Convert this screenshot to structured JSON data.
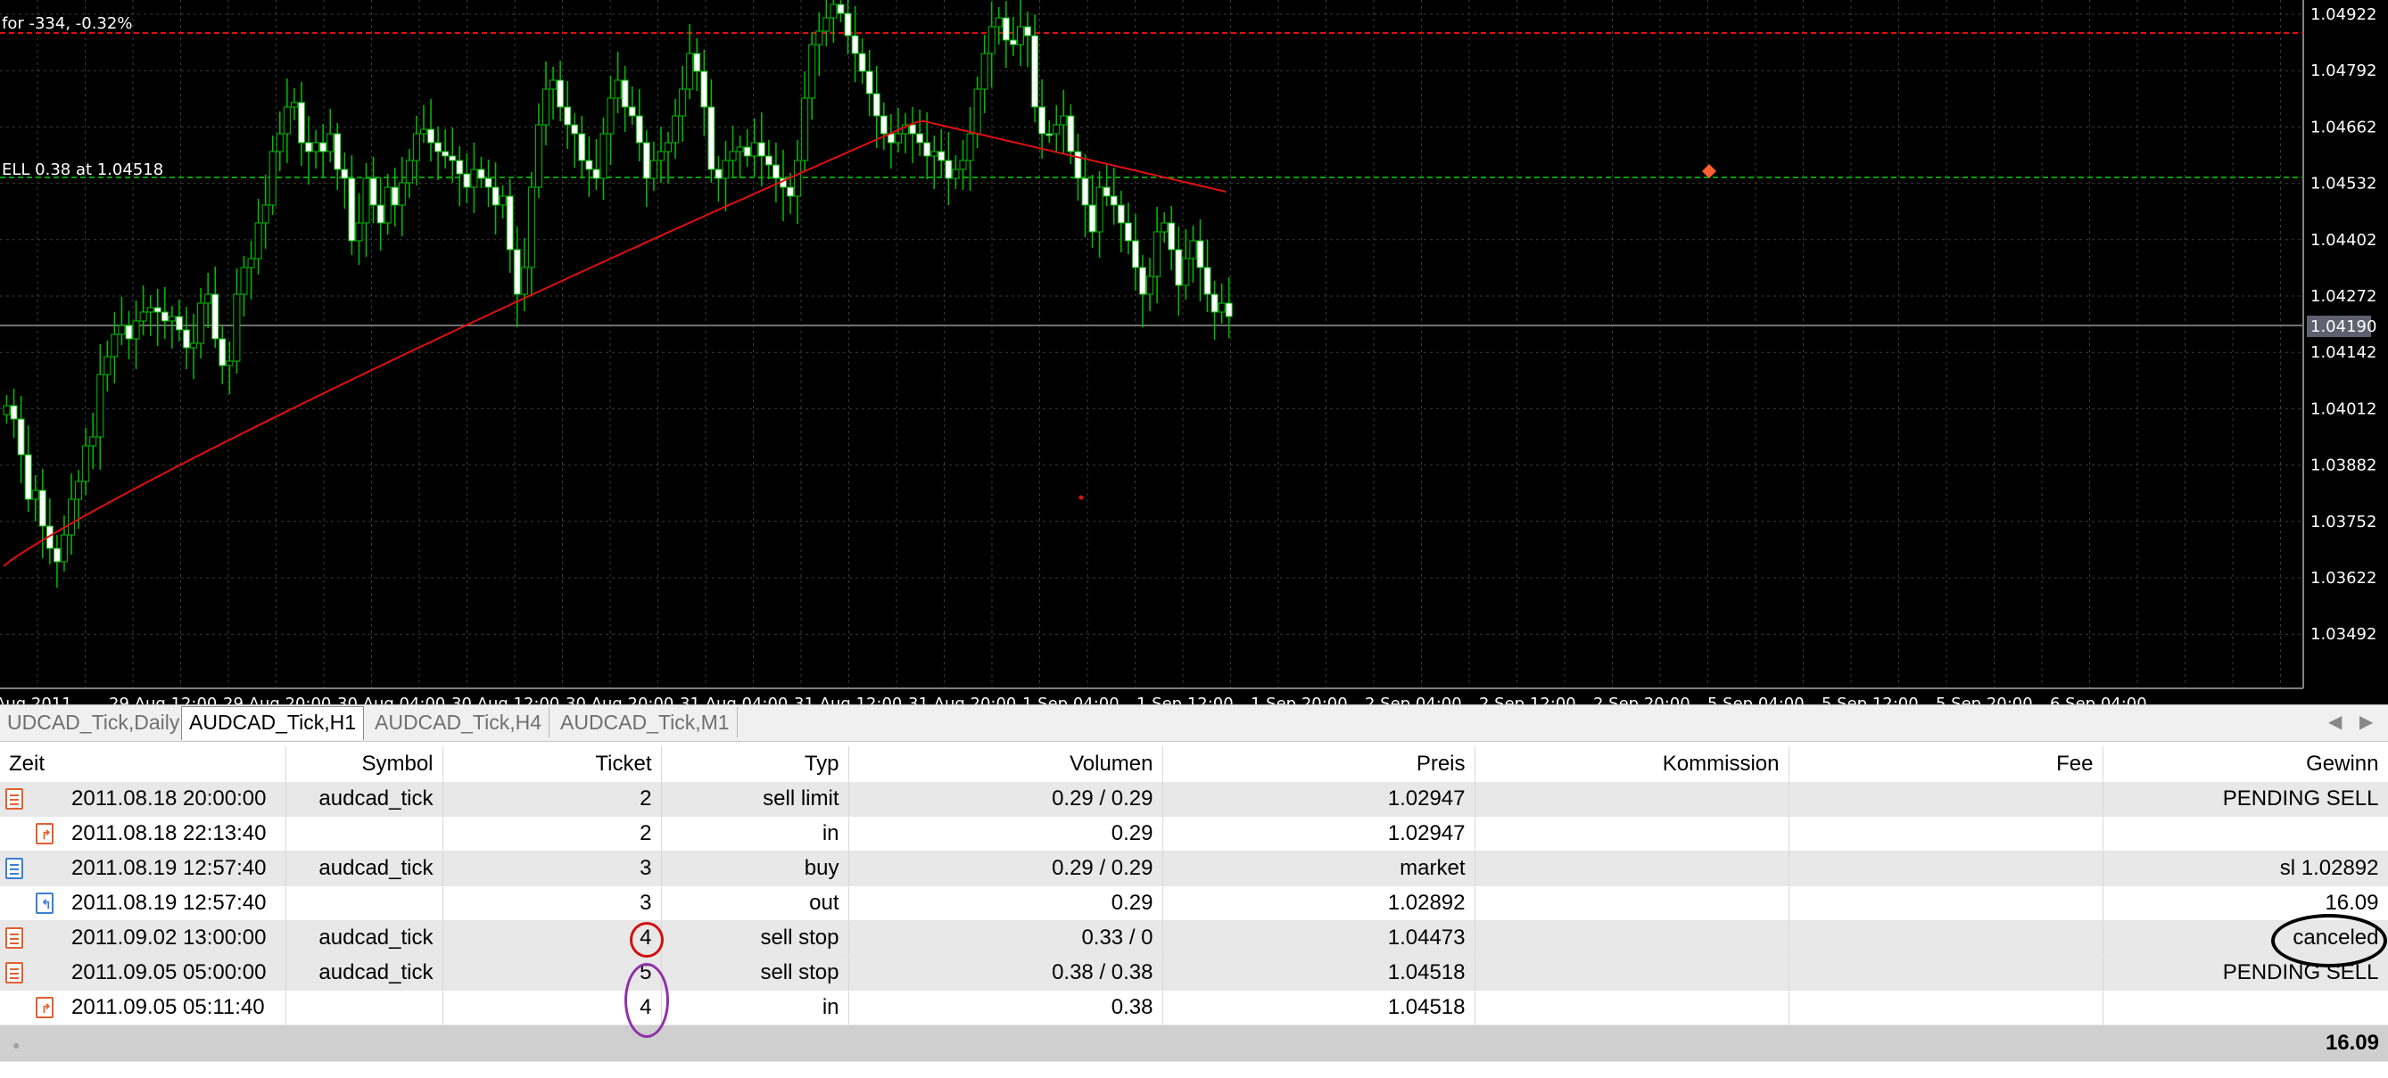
{
  "chart": {
    "overlay_top": "for -334, -0.32%",
    "overlay_order": "ELL 0.38 at 1.04518",
    "prefix_top": "",
    "price_labels": [
      "1.04922",
      "1.04792",
      "1.04662",
      "1.04532",
      "1.04402",
      "1.04272",
      "1.04142",
      "1.04012",
      "1.03882",
      "1.03752",
      "1.03622",
      "1.03492"
    ],
    "current_price": "1.04190",
    "time_labels": [
      "Aug 2011",
      "29 Aug 12:00",
      "29 Aug 20:00",
      "30 Aug 04:00",
      "30 Aug 12:00",
      "30 Aug 20:00",
      "31 Aug 04:00",
      "31 Aug 12:00",
      "31 Aug 20:00",
      "1 Sep 04:00",
      "1 Sep 12:00",
      "1 Sep 20:00",
      "2 Sep 04:00",
      "2 Sep 12:00",
      "2 Sep 20:00",
      "5 Sep 04:00",
      "5 Sep 12:00",
      "5 Sep 20:00",
      "6 Sep 04:00"
    ],
    "colors": {
      "background": "#000000",
      "bull_body": "#000000",
      "bear_body": "#ffffff",
      "wick": "#00c000",
      "ma": "#e01010",
      "grid": "#3a3a3a",
      "line_red": "#e01010",
      "line_green": "#00a000"
    }
  },
  "tabs": [
    {
      "label": "UDCAD_Tick,Daily",
      "active": false
    },
    {
      "label": "AUDCAD_Tick,H1",
      "active": true
    },
    {
      "label": "AUDCAD_Tick,H4",
      "active": false
    },
    {
      "label": "AUDCAD_Tick,M1",
      "active": false
    }
  ],
  "tab_arrows": {
    "left": "◀",
    "right": "▶"
  },
  "table": {
    "headers": [
      "Zeit",
      "Symbol",
      "Ticket",
      "Typ",
      "Volumen",
      "Preis",
      "Kommission",
      "Fee",
      "Gewinn"
    ],
    "rows": [
      {
        "icon": "order",
        "indent": false,
        "zeit": "2011.08.18 20:00:00",
        "symbol": "audcad_tick",
        "ticket": "2",
        "typ": "sell limit",
        "volumen": "0.29 / 0.29",
        "preis": "1.02947",
        "kommission": "",
        "fee": "",
        "gewinn": "PENDING SELL",
        "gray": true
      },
      {
        "icon": "deal-sell",
        "indent": true,
        "zeit": "2011.08.18 22:13:40",
        "symbol": "",
        "ticket": "2",
        "typ": "in",
        "volumen": "0.29",
        "preis": "1.02947",
        "kommission": "",
        "fee": "",
        "gewinn": "",
        "gray": false
      },
      {
        "icon": "order-buy",
        "indent": false,
        "zeit": "2011.08.19 12:57:40",
        "symbol": "audcad_tick",
        "ticket": "3",
        "typ": "buy",
        "volumen": "0.29 / 0.29",
        "preis": "market",
        "kommission": "",
        "fee": "",
        "gewinn": "sl 1.02892",
        "gray": true,
        "market": true
      },
      {
        "icon": "deal-buy",
        "indent": true,
        "zeit": "2011.08.19 12:57:40",
        "symbol": "",
        "ticket": "3",
        "typ": "out",
        "volumen": "0.29",
        "preis": "1.02892",
        "kommission": "",
        "fee": "",
        "gewinn": "16.09",
        "gray": false
      },
      {
        "icon": "order",
        "indent": false,
        "zeit": "2011.09.02 13:00:00",
        "symbol": "audcad_tick",
        "ticket": "4",
        "typ": "sell stop",
        "volumen": "0.33 / 0",
        "preis": "1.04473",
        "kommission": "",
        "fee": "",
        "gewinn": "canceled",
        "gray": true
      },
      {
        "icon": "order",
        "indent": false,
        "zeit": "2011.09.05 05:00:00",
        "symbol": "audcad_tick",
        "ticket": "5",
        "typ": "sell stop",
        "volumen": "0.38 / 0.38",
        "preis": "1.04518",
        "kommission": "",
        "fee": "",
        "gewinn": "PENDING SELL",
        "gray": true
      },
      {
        "icon": "deal-sell",
        "indent": true,
        "zeit": "2011.09.05 05:11:40",
        "symbol": "",
        "ticket": "4",
        "typ": "in",
        "volumen": "0.38",
        "preis": "1.04518",
        "kommission": "",
        "fee": "",
        "gewinn": "",
        "gray": false
      }
    ],
    "total": "16.09"
  }
}
